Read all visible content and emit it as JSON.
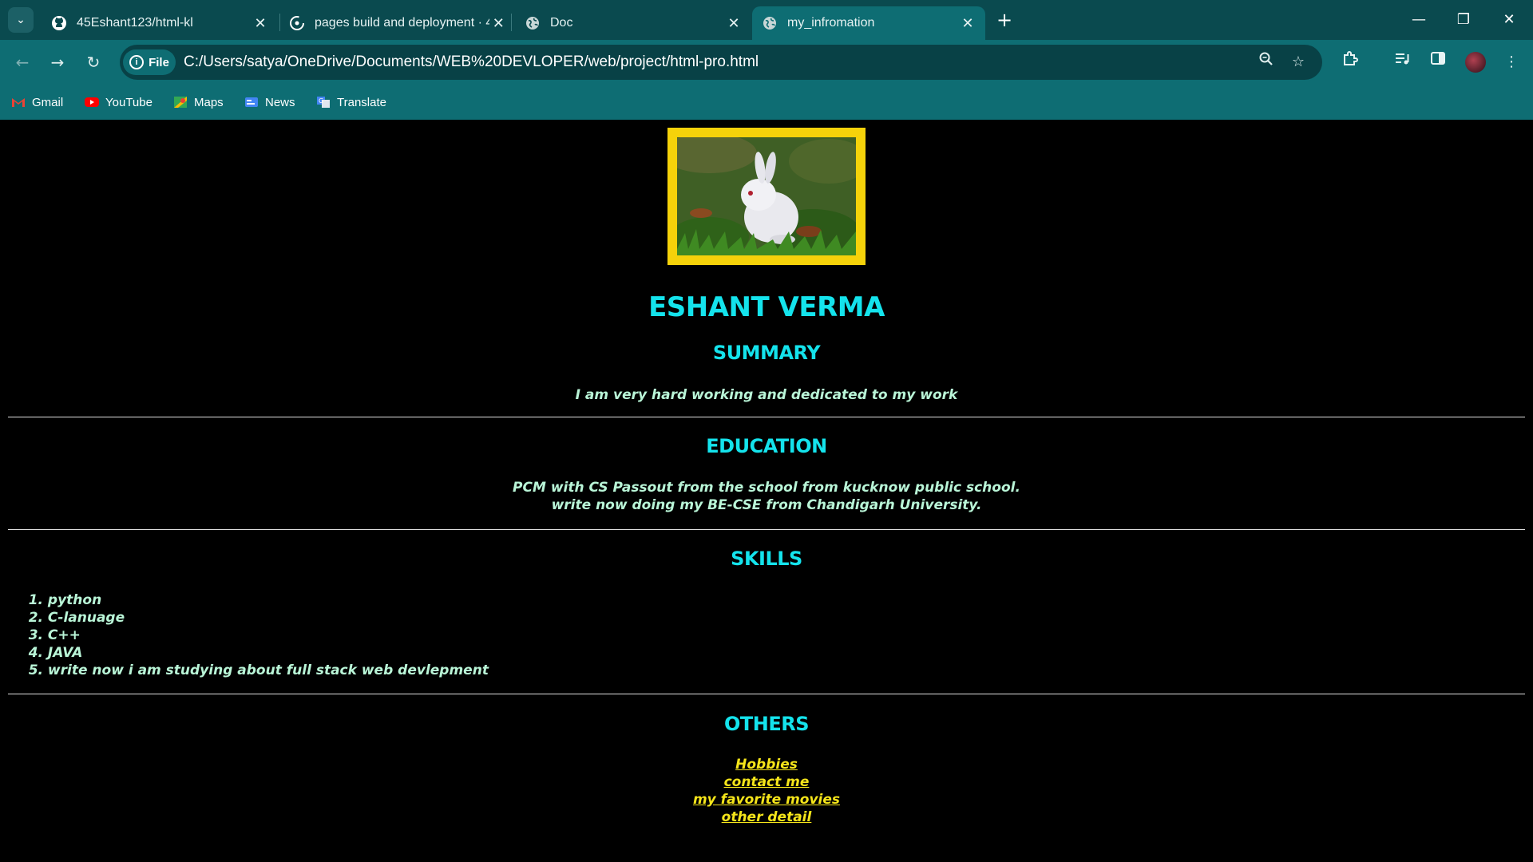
{
  "browser": {
    "tabs": [
      {
        "title": "45Eshant123/html-kl",
        "icon": "github-icon",
        "active": false
      },
      {
        "title": "pages build and deployment · 4",
        "icon": "github-actions-icon",
        "active": false
      },
      {
        "title": "Doc",
        "icon": "globe-icon",
        "active": false
      },
      {
        "title": "my_infromation",
        "icon": "globe-icon",
        "active": true
      }
    ],
    "new_tab_label": "+",
    "site_chip": "File",
    "url": "C:/Users/satya/OneDrive/Documents/WEB%20DEVLOPER/web/project/html-pro.html",
    "bookmarks": [
      {
        "label": "Gmail",
        "color": "#ea4335"
      },
      {
        "label": "YouTube",
        "color": "#ff0000"
      },
      {
        "label": "Maps",
        "color": "#34a853"
      },
      {
        "label": "News",
        "color": "#4285f4"
      },
      {
        "label": "Translate",
        "color": "#4285f4"
      }
    ]
  },
  "profile": {
    "photo_alt": "white rabbit on grass",
    "name": "ESHANT VERMA",
    "summary": {
      "heading": "SUMMARY",
      "text": "I am very hard working and dedicated to my work"
    },
    "education": {
      "heading": "EDUCATION",
      "line1": "PCM with CS Passout from the school from kucknow public school.",
      "line2": "write now doing my BE-CSE from Chandigarh University."
    },
    "skills": {
      "heading": "SKILLS",
      "items": [
        {
          "num": "1.",
          "label": "python"
        },
        {
          "num": "2.",
          "label": "C-lanuage"
        },
        {
          "num": "3.",
          "label": "C++"
        },
        {
          "num": "4.",
          "label": "JAVA"
        },
        {
          "num": "5.",
          "label": "write now i am studying about full stack web devlepment"
        }
      ]
    },
    "others": {
      "heading": "OTHERS",
      "links": [
        "Hobbies",
        "contact me",
        "my favorite movies",
        "other detail"
      ]
    }
  },
  "colors": {
    "heading": "#14e3ec",
    "text": "#b9f5d7",
    "link": "#f5e51a",
    "frame": "#f5d20a",
    "chrome": "#0e6d73"
  }
}
